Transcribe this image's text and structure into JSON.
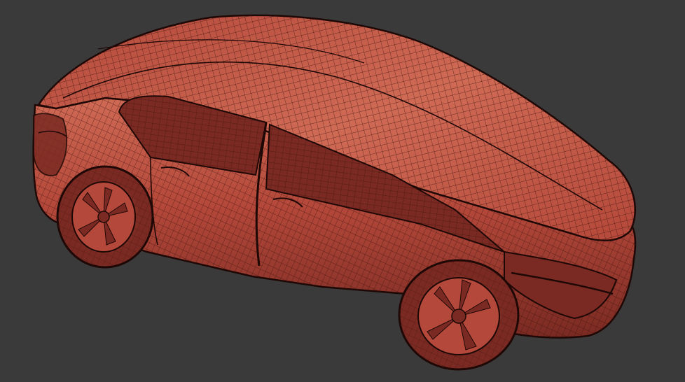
{
  "viewport": {
    "background_color": "#3a3a3a",
    "render_mode": "wireframe-on-shaded"
  },
  "model": {
    "subject": "hatchback car",
    "surface_color": "#b4483a",
    "shadow_color": "#7a2a22",
    "highlight_color": "#cf6a55",
    "wire_color": "#3a100c",
    "outline_color": "#1e0806"
  }
}
